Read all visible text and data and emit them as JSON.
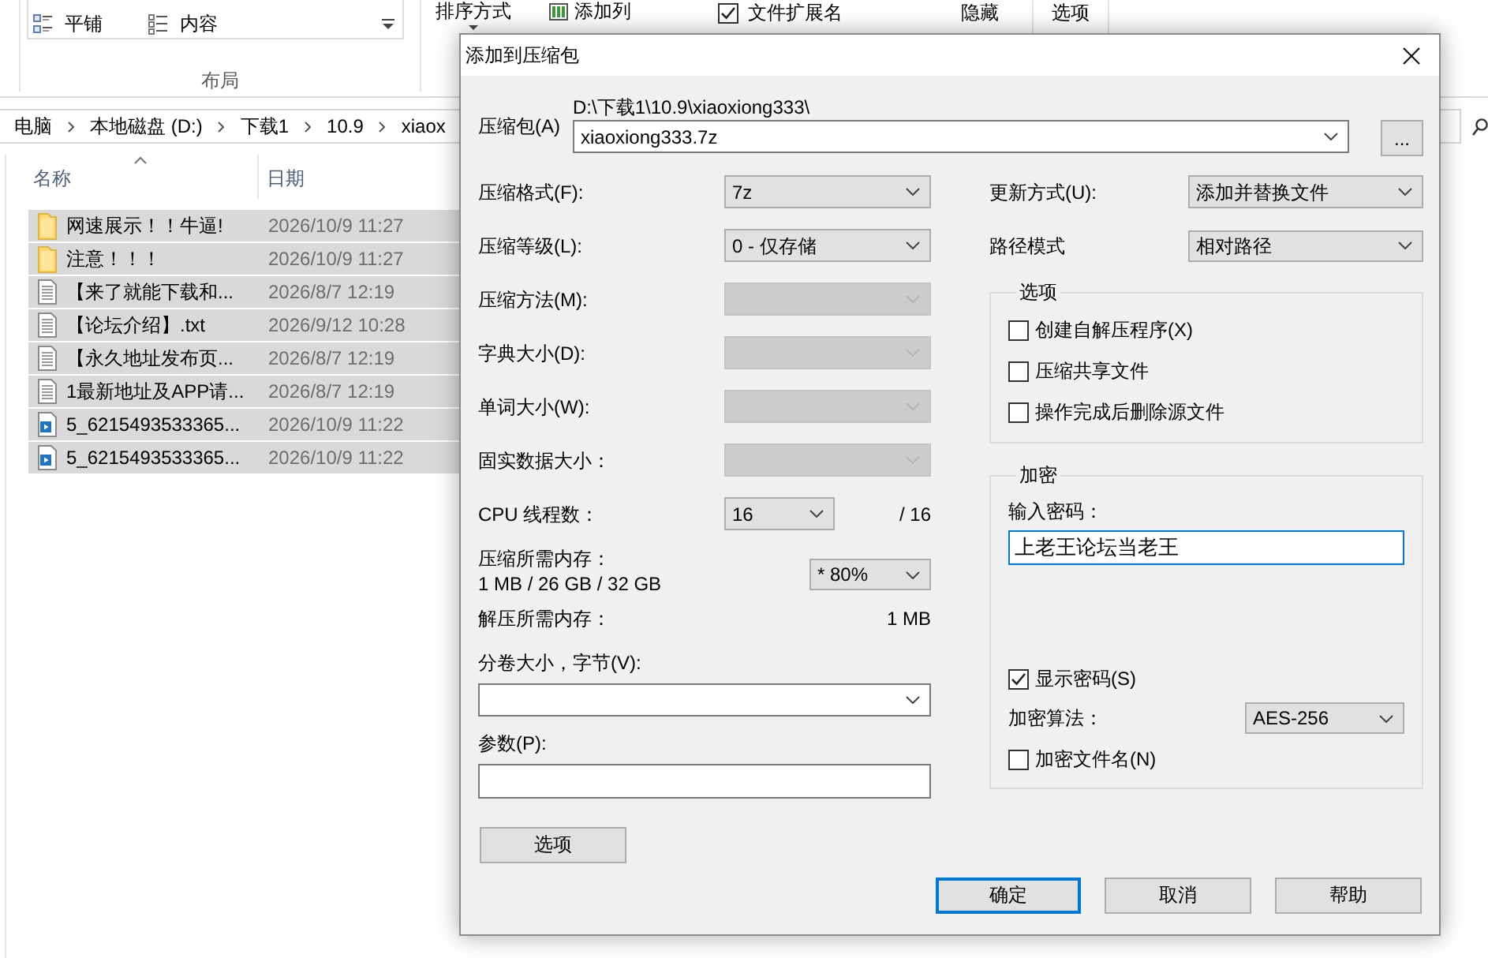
{
  "explorer": {
    "ribbon": {
      "layout_items": [
        {
          "kind": "tiles",
          "label": "平铺"
        },
        {
          "kind": "content",
          "label": "内容"
        }
      ],
      "layout_group_label": "布局",
      "sort_button": "排序方式",
      "add_columns_button": "添加列",
      "file_extensions": {
        "label": "文件扩展名",
        "checked": true
      },
      "hide_button": "隐藏",
      "options_button": "选项"
    },
    "breadcrumb": [
      "电脑",
      "本地磁盘 (D:)",
      "下载1",
      "10.9",
      "xiaox"
    ],
    "columns": [
      {
        "label": "名称",
        "sorted": true
      },
      {
        "label": "日期",
        "sorted": false
      }
    ],
    "files": [
      {
        "kind": "folder",
        "name": "网速展示！！牛逼!",
        "date": "2026/10/9 11:27",
        "selected": true
      },
      {
        "kind": "folder",
        "name": "注意！！！",
        "date": "2026/10/9 11:27",
        "selected": true
      },
      {
        "kind": "text",
        "name": "【来了就能下载和...",
        "date": "2026/8/7 12:19",
        "selected": true
      },
      {
        "kind": "text",
        "name": "【论坛介绍】.txt",
        "date": "2026/9/12 10:28",
        "selected": true
      },
      {
        "kind": "text",
        "name": "【永久地址发布页...",
        "date": "2026/8/7 12:19",
        "selected": true
      },
      {
        "kind": "text",
        "name": "1最新地址及APP请...",
        "date": "2026/8/7 12:19",
        "selected": true
      },
      {
        "kind": "media",
        "name": "5_6215493533365...",
        "date": "2026/10/9 11:22",
        "selected": true
      },
      {
        "kind": "media",
        "name": "5_6215493533365...",
        "date": "2026/10/9 11:22",
        "selected": true
      }
    ]
  },
  "dialog": {
    "title": "添加到压缩包",
    "archive": {
      "label": "压缩包(A)",
      "path": "D:\\下载1\\10.9\\xiaoxiong333\\",
      "value": "xiaoxiong333.7z",
      "browse_button": "..."
    },
    "settings": [
      {
        "label": "压缩格式(F):",
        "value": "7z",
        "disabled": false
      },
      {
        "label": "压缩等级(L):",
        "value": "0 - 仅存储",
        "disabled": false
      },
      {
        "label": "压缩方法(M):",
        "disabled": true
      },
      {
        "label": "字典大小(D):",
        "disabled": true
      },
      {
        "label": "单词大小(W):",
        "disabled": true
      },
      {
        "label": "固实数据大小：",
        "disabled": true
      }
    ],
    "threads": {
      "label": "CPU 线程数：",
      "value": "16",
      "max": "/ 16"
    },
    "compress_memory": {
      "label": "压缩所需内存：",
      "usage": "1 MB / 26 GB / 32 GB",
      "value": "* 80%"
    },
    "decompress_memory": {
      "label": "解压所需内存：",
      "value": "1 MB"
    },
    "volume_size": {
      "label": "分卷大小，字节(V):"
    },
    "parameters": {
      "label": "参数(P):"
    },
    "options_button": "选项",
    "update_mode": {
      "label": "更新方式(U):",
      "value": "添加并替换文件"
    },
    "path_mode": {
      "label": "路径模式",
      "value": "相对路径"
    },
    "options_group": {
      "title": "选项",
      "checkboxes": [
        {
          "label": "创建自解压程序(X)",
          "checked": false
        },
        {
          "label": "压缩共享文件",
          "checked": false
        },
        {
          "label": "操作完成后删除源文件",
          "checked": false
        }
      ]
    },
    "encryption": {
      "title": "加密",
      "password_label": "输入密码：",
      "password": {
        "value": "上老王论坛当老王",
        "focused": true
      },
      "show_password": {
        "label": "显示密码(S)",
        "checked": true
      },
      "method_label": "加密算法：",
      "method": "AES-256",
      "encrypt_names": {
        "label": "加密文件名(N)",
        "checked": false
      }
    },
    "buttons": [
      {
        "label": "确定",
        "default": true
      },
      {
        "label": "取消",
        "default": false
      },
      {
        "label": "帮助",
        "default": false
      }
    ]
  }
}
